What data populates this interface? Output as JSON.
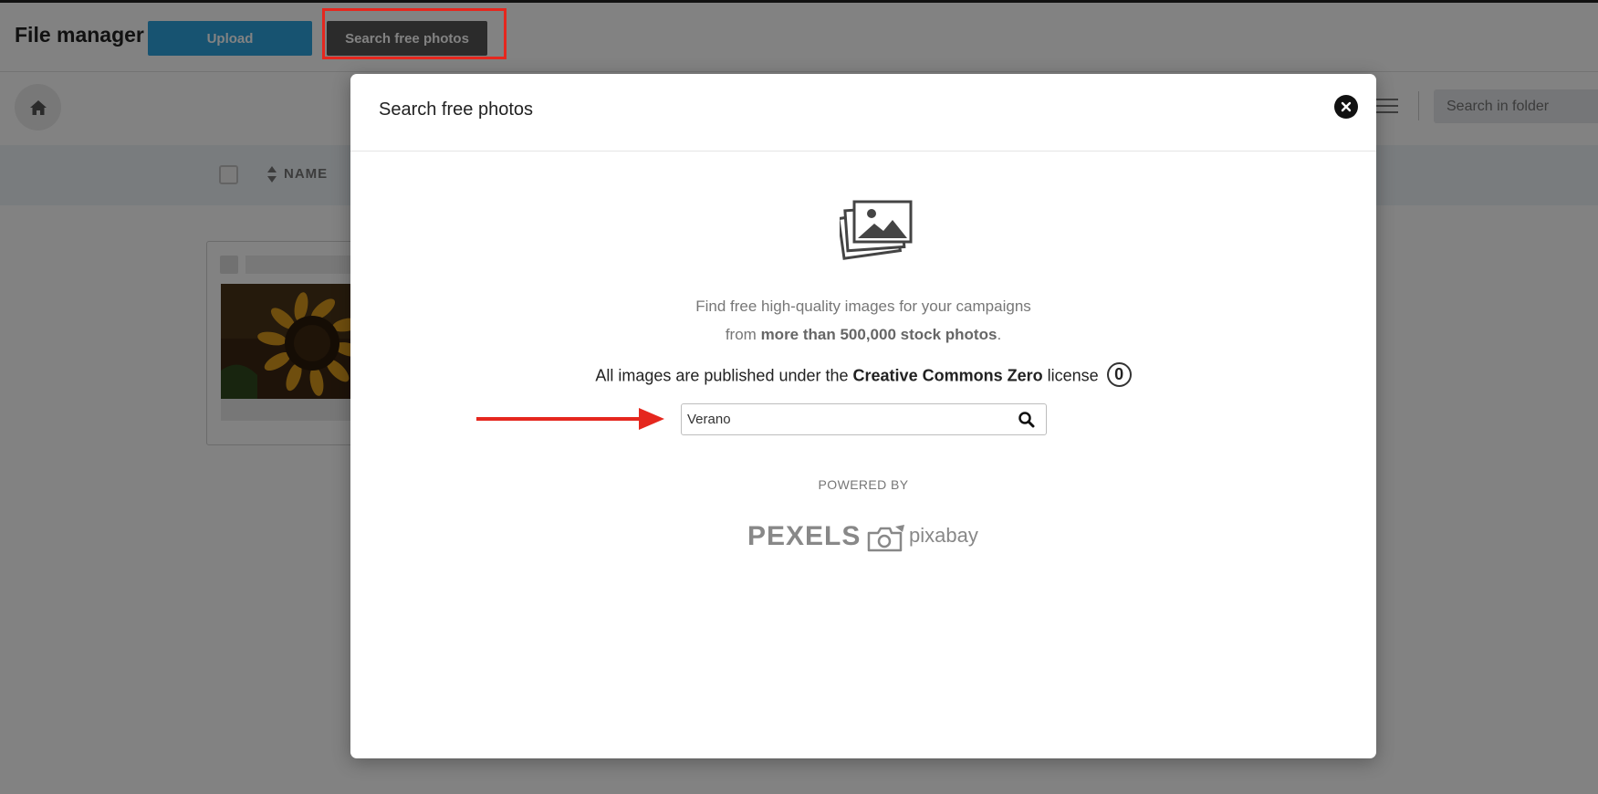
{
  "header": {
    "title": "File manager",
    "upload_label": "Upload",
    "search_photos_label": "Search free photos"
  },
  "toolbar": {
    "folder_search_placeholder": "Search in folder"
  },
  "table": {
    "name_column": "NAME"
  },
  "modal": {
    "title": "Search free photos",
    "description_line1": "Find free high-quality images for your campaigns",
    "description_line2_prefix": "from ",
    "description_line2_bold": "more than 500,000 stock photos",
    "description_line2_suffix": ".",
    "license_prefix": "All images are published under the ",
    "license_bold": "Creative Commons Zero",
    "license_suffix": " license",
    "cc0_symbol": "0",
    "search_value": "Verano",
    "powered_by": "POWERED BY",
    "pexels_label": "PEXELS",
    "pixabay_label": "pixabay"
  },
  "colors": {
    "accent_upload": "#2ea3dd",
    "annotation_red": "#e5271e",
    "overlay": "rgba(0,0,0,0.49)"
  },
  "icons": [
    "home-icon",
    "list-view-icon",
    "sort-icon",
    "close-icon",
    "gallery-icon",
    "cc0-icon",
    "search-icon",
    "camera-icon"
  ]
}
